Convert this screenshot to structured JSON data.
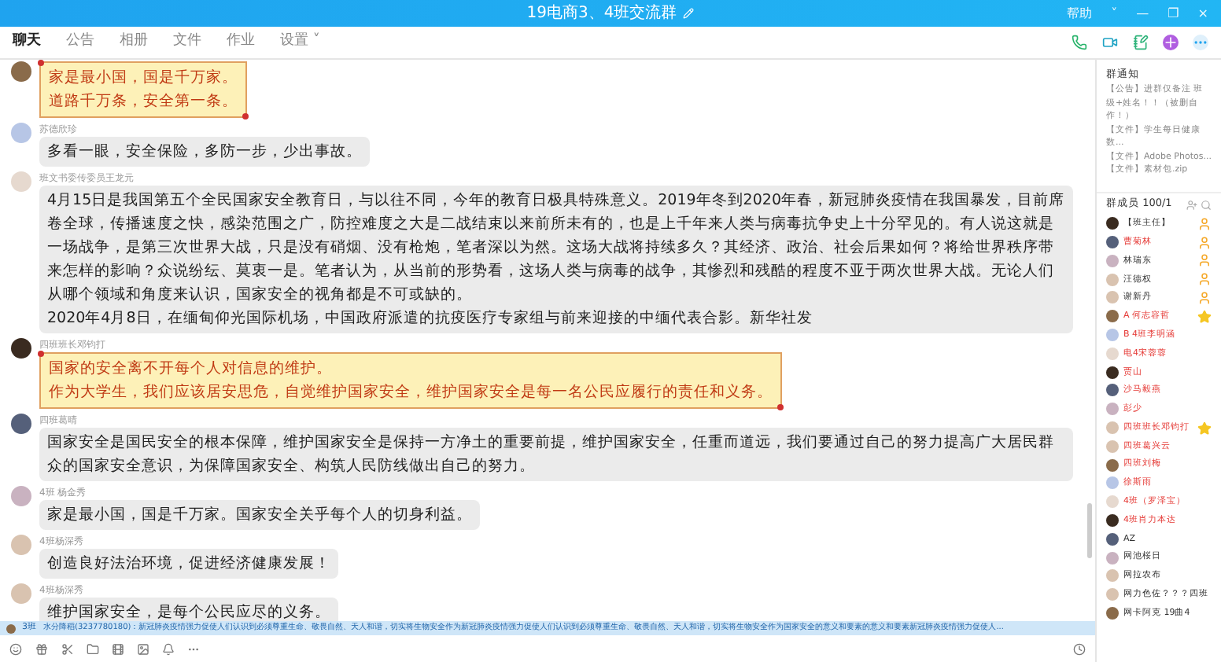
{
  "window": {
    "title": "19电商3、4班交流群",
    "controls": [
      "帮助",
      "˅",
      "—",
      "❐",
      "×"
    ]
  },
  "tabs": [
    {
      "label": "聊天",
      "selected": true
    },
    {
      "label": "公告",
      "selected": false
    },
    {
      "label": "相册",
      "selected": false
    },
    {
      "label": "文件",
      "selected": false
    },
    {
      "label": "作业",
      "selected": false
    },
    {
      "label": "设置 ˅",
      "selected": false
    }
  ],
  "messages": [
    {
      "kind": "note",
      "lines": [
        "家是最小国，国是千万家。",
        "道路千万条，安全第一条。"
      ]
    },
    {
      "kind": "bubble",
      "sender": "苏德欣珍",
      "lines": [
        "多看一眼，安全保险，多防一步，少出事故。"
      ]
    },
    {
      "kind": "bubble",
      "sender": "班文书委传委员王龙元",
      "lines": [
        "4月15日是我国第五个全民国家安全教育日，与以往不同，今年的教育日极具特殊意义。2019年冬到2020年春，新冠肺炎疫情在我国暴发，目前席卷全球，传播速度之快，感染范围之广，防控难度之大是二战结束以来前所未有的，也是上千年来人类与病毒抗争史上十分罕见的。有人说这就是一场战争，是第三次世界大战，只是没有硝烟、没有枪炮，笔者深以为然。这场大战将持续多久？其经济、政治、社会后果如何？将给世界秩序带来怎样的影响？众说纷纭、莫衷一是。笔者认为，从当前的形势看，这场人类与病毒的战争，其惨烈和残酷的程度不亚于两次世界大战。无论人们从哪个领域和角度来认识，国家安全的视角都是不可或缺的。",
        "2020年4月8日，在缅甸仰光国际机场，中国政府派遣的抗疫医疗专家组与前来迎接的中缅代表合影。新华社发"
      ]
    },
    {
      "kind": "note",
      "sender": "四班班长邓钧打",
      "lines": [
        "国家的安全离不开每个人对信息的维护。",
        "作为大学生，我们应该居安思危，自觉维护国家安全，维护国家安全是每一名公民应履行的责任和义务。"
      ]
    },
    {
      "kind": "bubble",
      "sender": "四班葛晴",
      "lines": [
        "国家安全是国民安全的根本保障，维护国家安全是保持一方净土的重要前提，维护国家安全，任重而道远，我们要通过自己的努力提高广大居民群众的国家安全意识，为保障国家安全、构筑人民防线做出自己的努力。"
      ]
    },
    {
      "kind": "bubble",
      "sender": "4班 杨金秀",
      "lines": [
        "家是最小国，国是千万家。国家安全关乎每个人的切身利益。"
      ]
    },
    {
      "kind": "bubble",
      "sender": "4班杨深秀",
      "lines": [
        "创造良好法治环境，促进经济健康发展！"
      ]
    },
    {
      "kind": "bubble",
      "sender": "4班杨深秀",
      "lines": [
        "维护国家安全，是每个公民应尽的义务。"
      ]
    }
  ],
  "ticker": {
    "tag": "3班",
    "text": "水分降稻(3237780180)：新冠肺炎疫情强力促使人们认识到必须尊重生命、敬畏自然、天人和谐，切实将生物安全作为新冠肺炎疫情强力促使人们认识到必须尊重生命、敬畏自然、天人和谐，切实将生物安全作为国家安全的意义和要素的意义和要素新冠肺炎疫情强力促使人..."
  },
  "notice": {
    "title": "群通知",
    "items": [
      "【公告】进群仅备注 班级+姓名！！（被删自作！）",
      "【文件】学生每日健康数...",
      "【文件】Adobe Photos...",
      "【文件】素材包.zip"
    ]
  },
  "members": {
    "title": "群成员 100/1",
    "list": [
      {
        "name": "【班主任】",
        "highlighted": false,
        "admin": true,
        "starred": false
      },
      {
        "name": "曹菊林",
        "highlighted": true,
        "admin": true,
        "starred": false
      },
      {
        "name": "林瑞东",
        "highlighted": false,
        "admin": true,
        "starred": false
      },
      {
        "name": "汪德权",
        "highlighted": false,
        "admin": true,
        "starred": false
      },
      {
        "name": "谢新丹",
        "highlighted": false,
        "admin": true,
        "starred": false
      },
      {
        "name": "A 何志容哲",
        "highlighted": true,
        "admin": false,
        "starred": true
      },
      {
        "name": "B 4班李明涵",
        "highlighted": true,
        "admin": false,
        "starred": false
      },
      {
        "name": "电4宋蓉蓉",
        "highlighted": true,
        "admin": false,
        "starred": false
      },
      {
        "name": "贾山",
        "highlighted": true,
        "admin": false,
        "starred": false
      },
      {
        "name": "沙马毅燕",
        "highlighted": true,
        "admin": false,
        "starred": false
      },
      {
        "name": "彭少",
        "highlighted": true,
        "admin": false,
        "starred": false
      },
      {
        "name": "四班班长邓钧打",
        "highlighted": true,
        "admin": false,
        "starred": true
      },
      {
        "name": "四班葛兴云",
        "highlighted": true,
        "admin": false,
        "starred": false
      },
      {
        "name": "四班刘梅",
        "highlighted": true,
        "admin": false,
        "starred": false
      },
      {
        "name": "徐斯雨",
        "highlighted": true,
        "admin": false,
        "starred": false
      },
      {
        "name": "4班（罗泽宝）",
        "highlighted": true,
        "admin": false,
        "starred": false
      },
      {
        "name": "4班肖力本达",
        "highlighted": true,
        "admin": false,
        "starred": false
      },
      {
        "name": "AZ",
        "highlighted": false,
        "admin": false,
        "starred": false
      },
      {
        "name": "网池桜日",
        "highlighted": false,
        "admin": false,
        "starred": false
      },
      {
        "name": "网拉农布",
        "highlighted": false,
        "admin": false,
        "starred": false
      },
      {
        "name": "网力色佐？？？四班",
        "highlighted": false,
        "admin": false,
        "starred": false
      },
      {
        "name": "网卡阿克 19曲4",
        "highlighted": false,
        "admin": false,
        "starred": false
      }
    ]
  }
}
